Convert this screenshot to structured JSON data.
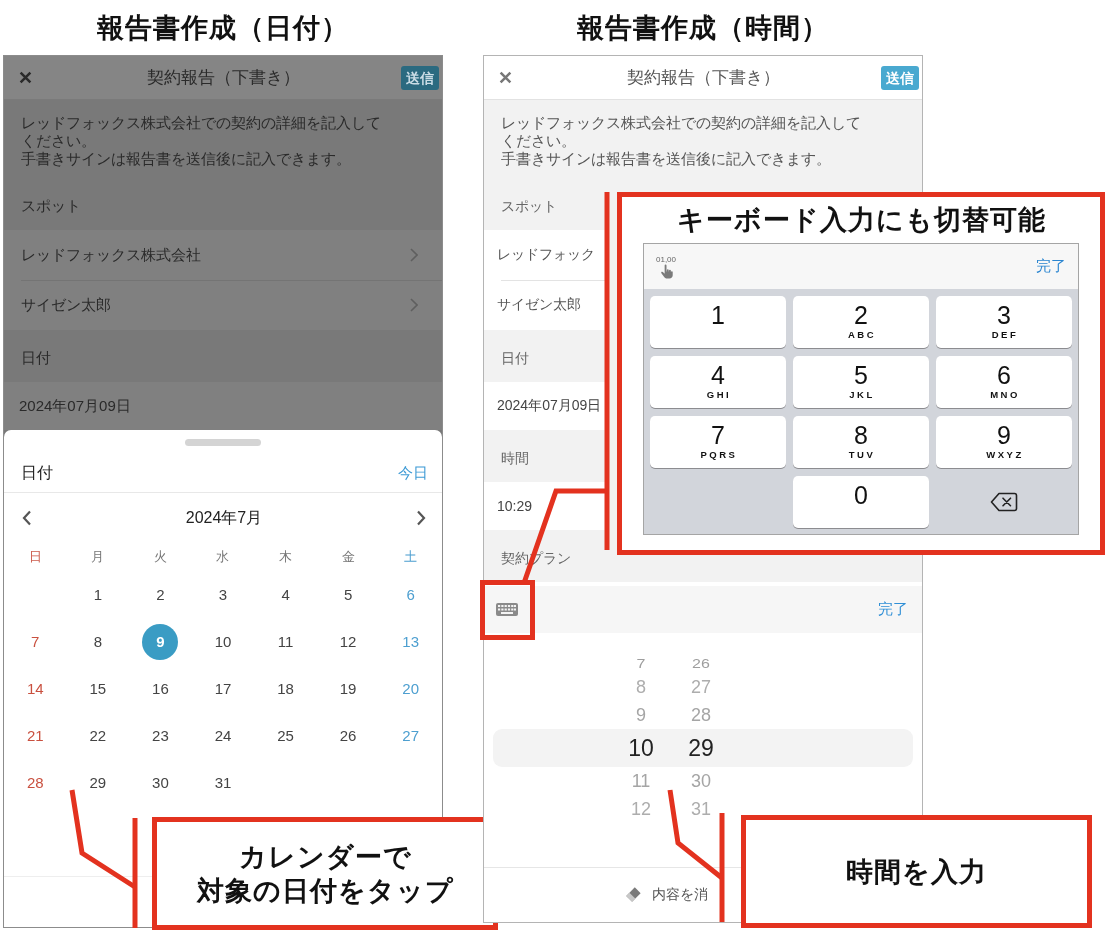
{
  "panels": [
    {
      "heading": "報告書作成（日付）",
      "screen": {
        "dimmed": true,
        "nav": {
          "title": "契約報告（下書き）",
          "send_button": "送信"
        },
        "description": [
          "レッドフォックス株式会社での契約の詳細を記入してください。",
          "手書きサインは報告書を送信後に記入できます。"
        ],
        "rows": [
          {
            "kind": "label",
            "text": "スポット"
          },
          {
            "kind": "item",
            "text": "レッドフォックス株式会社",
            "chevron": true
          },
          {
            "kind": "item",
            "text": "サイゼン太郎",
            "chevron": true
          },
          {
            "kind": "label",
            "text": "日付"
          },
          {
            "kind": "value",
            "text": "2024年07月09日"
          }
        ],
        "sheet": {
          "kind": "calendar",
          "title": "日付",
          "today_button": "今日",
          "month": "2024年7月",
          "weekdays": [
            "日",
            "月",
            "火",
            "水",
            "木",
            "金",
            "土"
          ],
          "weeks": [
            [
              {
                "label": "1",
                "selected": false
              },
              {
                "label": "2",
                "selected": false
              },
              {
                "label": "3",
                "selected": false
              },
              {
                "label": "4",
                "selected": false
              },
              {
                "label": "5",
                "selected": false
              },
              {
                "label": "6",
                "selected": false
              }
            ],
            [
              {
                "label": "7",
                "selected": false
              },
              {
                "label": "8",
                "selected": false
              },
              {
                "label": "9",
                "selected": true
              },
              {
                "label": "10",
                "selected": false
              },
              {
                "label": "11",
                "selected": false
              },
              {
                "label": "12",
                "selected": false
              },
              {
                "label": "13",
                "selected": false
              }
            ],
            [
              {
                "label": "14",
                "selected": false
              },
              {
                "label": "15",
                "selected": false
              },
              {
                "label": "16",
                "selected": false
              },
              {
                "label": "17",
                "selected": false
              },
              {
                "label": "18",
                "selected": false
              },
              {
                "label": "19",
                "selected": false
              },
              {
                "label": "20",
                "selected": false
              }
            ],
            [
              {
                "label": "21",
                "selected": false
              },
              {
                "label": "22",
                "selected": false
              },
              {
                "label": "23",
                "selected": false
              },
              {
                "label": "24",
                "selected": false
              },
              {
                "label": "25",
                "selected": false
              },
              {
                "label": "26",
                "selected": false
              },
              {
                "label": "27",
                "selected": false
              }
            ],
            [
              {
                "label": "28",
                "selected": false
              },
              {
                "label": "29",
                "selected": false
              },
              {
                "label": "30",
                "selected": false
              },
              {
                "label": "31",
                "selected": false
              }
            ]
          ]
        }
      },
      "callouts": [
        {
          "kind": "note",
          "lines": [
            "カレンダーで",
            "対象の日付をタップ"
          ]
        }
      ]
    },
    {
      "heading": "報告書作成（時間）",
      "screen": {
        "dimmed": false,
        "nav": {
          "title": "契約報告（下書き）",
          "send_button": "送信"
        },
        "description": [
          "レッドフォックス株式会社での契約の詳細を記入してください。",
          "手書きサインは報告書を送信後に記入できます。"
        ],
        "rows": [
          {
            "kind": "label",
            "text": "スポット"
          },
          {
            "kind": "item",
            "text": "レッドフォック",
            "chevron": false
          },
          {
            "kind": "item",
            "text": "サイゼン太郎",
            "chevron": false
          },
          {
            "kind": "label",
            "text": "日付"
          },
          {
            "kind": "value",
            "text": "2024年07月09日"
          },
          {
            "kind": "label",
            "text": "時間"
          },
          {
            "kind": "value",
            "text": "10:29"
          },
          {
            "kind": "label",
            "text": "契約プラン"
          }
        ],
        "sheet": {
          "kind": "time_picker",
          "done_button": "完了",
          "columns": [
            {
              "items": [
                {
                  "label": "7",
                  "selected": false
                },
                {
                  "label": "8",
                  "selected": false
                },
                {
                  "label": "9",
                  "selected": false
                },
                {
                  "label": "10",
                  "selected": true
                },
                {
                  "label": "11",
                  "selected": false
                },
                {
                  "label": "12",
                  "selected": false
                }
              ]
            },
            {
              "items": [
                {
                  "label": "26",
                  "selected": false
                },
                {
                  "label": "27",
                  "selected": false
                },
                {
                  "label": "28",
                  "selected": false
                },
                {
                  "label": "29",
                  "selected": true
                },
                {
                  "label": "30",
                  "selected": false
                },
                {
                  "label": "31",
                  "selected": false
                }
              ]
            }
          ],
          "clear_button": "内容を消"
        }
      },
      "callouts": [
        {
          "kind": "keypad",
          "title": "キーボード入力にも切替可能",
          "keypad": {
            "format_toggle": "01,00",
            "done_button": "完了",
            "rows": [
              [
                {
                  "kind": "digit",
                  "digit": "1"
                },
                {
                  "kind": "digit",
                  "digit": "2",
                  "letters": "ABC"
                },
                {
                  "kind": "digit",
                  "digit": "3",
                  "letters": "DEF"
                }
              ],
              [
                {
                  "kind": "digit",
                  "digit": "4",
                  "letters": "GHI"
                },
                {
                  "kind": "digit",
                  "digit": "5",
                  "letters": "JKL"
                },
                {
                  "kind": "digit",
                  "digit": "6",
                  "letters": "MNO"
                }
              ],
              [
                {
                  "kind": "digit",
                  "digit": "7",
                  "letters": "PQRS"
                },
                {
                  "kind": "digit",
                  "digit": "8",
                  "letters": "TUV"
                },
                {
                  "kind": "digit",
                  "digit": "9",
                  "letters": "WXYZ"
                }
              ],
              [
                "",
                {
                  "kind": "digit",
                  "digit": "0"
                },
                {
                  "kind": "delete"
                }
              ]
            ]
          }
        },
        {
          "kind": "note",
          "lines": [
            "時間を入力"
          ]
        }
      ]
    }
  ]
}
